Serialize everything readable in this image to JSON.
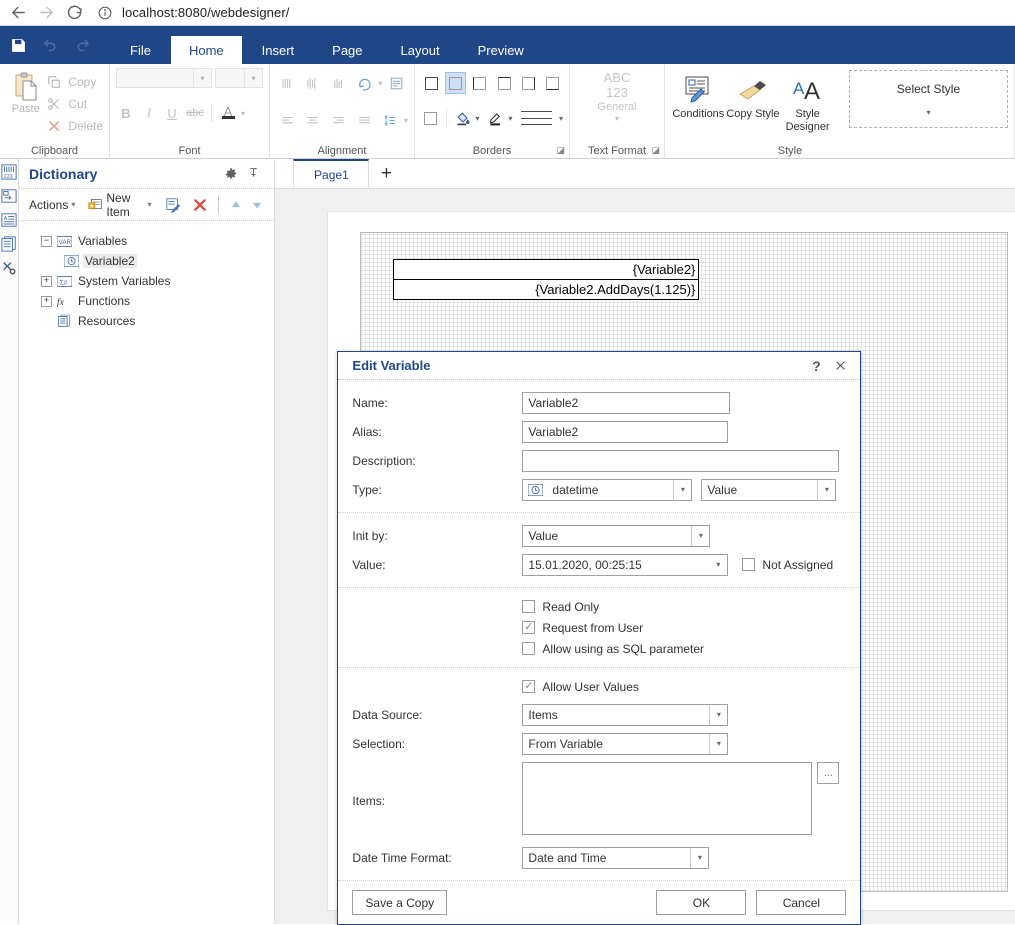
{
  "browser": {
    "back_icon": "arrow-left-icon",
    "forward_icon": "arrow-right-icon",
    "reload_icon": "reload-icon",
    "info_icon": "info-circle-icon",
    "url": "localhost:8080/webdesigner/"
  },
  "ribbon": {
    "save_icon": "save-icon",
    "undo_icon": "undo-icon",
    "redo_icon": "redo-icon",
    "tabs": [
      {
        "label": "File",
        "active": false
      },
      {
        "label": "Home",
        "active": true
      },
      {
        "label": "Insert",
        "active": false
      },
      {
        "label": "Page",
        "active": false
      },
      {
        "label": "Layout",
        "active": false
      },
      {
        "label": "Preview",
        "active": false
      }
    ],
    "groups": {
      "clipboard": {
        "label": "Clipboard",
        "paste": "Paste",
        "copy": "Copy",
        "cut": "Cut",
        "delete": "Delete"
      },
      "font": {
        "label": "Font",
        "font_name": "",
        "font_size": "",
        "bold": "B",
        "italic": "I",
        "underline": "U",
        "strikethrough": "abc",
        "font_color": "A"
      },
      "alignment": {
        "label": "Alignment"
      },
      "borders": {
        "label": "Borders"
      },
      "text_format": {
        "label": "Text Format",
        "line1": "ABC",
        "line2": "123",
        "line3": "General"
      },
      "style": {
        "label": "Style",
        "conditions": "Conditions",
        "copy_style": "Copy Style",
        "style_designer_line1": "Style",
        "style_designer_line2": "Designer",
        "select_style": "Select Style"
      }
    }
  },
  "rail": {
    "icons": [
      "dictionary-icon",
      "report-tree-icon",
      "properties-icon",
      "pages-icon",
      "tools-icon"
    ]
  },
  "dictionary": {
    "title": "Dictionary",
    "gear_icon": "gear-icon",
    "pin_icon": "pin-icon",
    "toolbar": {
      "actions": "Actions",
      "new_item": "New Item",
      "edit_icon": "edit-icon",
      "delete_icon": "delete-x-icon",
      "move_up_icon": "arrow-up-icon",
      "move_down_icon": "arrow-down-icon"
    },
    "tree": [
      {
        "label": "Variables",
        "expander": "−",
        "icon": "var-icon",
        "indent": false,
        "selected": false
      },
      {
        "label": "Variable2",
        "expander": "",
        "icon": "datetime-icon",
        "indent": true,
        "selected": true
      },
      {
        "label": "System Variables",
        "expander": "+",
        "icon": "sysvar-icon",
        "indent": false,
        "selected": false
      },
      {
        "label": "Functions",
        "expander": "+",
        "icon": "fx-icon",
        "indent": false,
        "selected": false
      },
      {
        "label": "Resources",
        "expander": "",
        "icon": "resources-icon",
        "indent": false,
        "selected": false
      }
    ]
  },
  "designer": {
    "page_tabs": [
      {
        "label": "Page1",
        "active": true
      }
    ],
    "add_page_label": "+",
    "report_texts": [
      "{Variable2}",
      "{Variable2.AddDays(1.125)}"
    ]
  },
  "dialog": {
    "title": "Edit Variable",
    "help_icon": "question-mark-icon",
    "close_icon": "close-x-icon",
    "fields": {
      "name_label": "Name:",
      "name_value": "Variable2",
      "alias_label": "Alias:",
      "alias_value": "Variable2",
      "description_label": "Description:",
      "description_value": "",
      "type_label": "Type:",
      "type_value": "datetime",
      "type_icon": "datetime-icon",
      "type_kind_value": "Value",
      "init_by_label": "Init by:",
      "init_by_value": "Value",
      "value_label": "Value:",
      "value_value": "15.01.2020, 00:25:15",
      "not_assigned_label": "Not Assigned",
      "not_assigned_checked": false,
      "read_only_label": "Read Only",
      "read_only_checked": false,
      "request_from_user_label": "Request from User",
      "request_from_user_checked": true,
      "allow_sql_label": "Allow using as SQL parameter",
      "allow_sql_checked": false,
      "allow_user_values_label": "Allow User Values",
      "allow_user_values_checked": true,
      "data_source_label": "Data Source:",
      "data_source_value": "Items",
      "selection_label": "Selection:",
      "selection_value": "From Variable",
      "items_label": "Items:",
      "items_value": "",
      "items_browse_label": "...",
      "date_time_format_label": "Date Time Format:",
      "date_time_format_value": "Date and Time"
    },
    "buttons": {
      "save_a_copy": "Save a Copy",
      "ok": "OK",
      "cancel": "Cancel"
    }
  },
  "colors": {
    "ribbon_blue": "#1f4788",
    "accent_text": "#1f4788",
    "canvas_gray": "#f0f0f0",
    "border_gray": "#a0a0a0"
  }
}
